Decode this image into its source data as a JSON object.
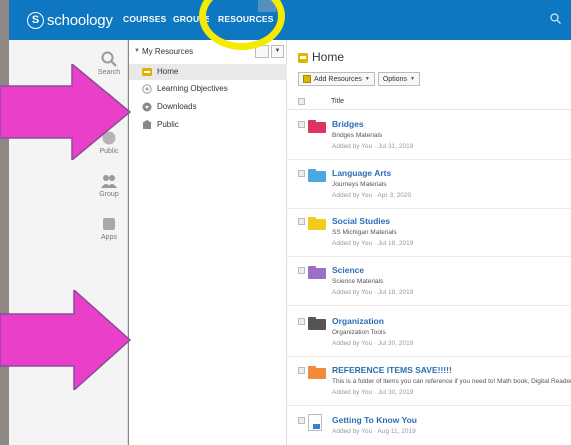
{
  "topbar": {
    "logo_glyph": "S",
    "logo_text": "schoology",
    "nav": [
      {
        "label": "COURSES"
      },
      {
        "label": "GROUPS"
      },
      {
        "label": "RESOURCES"
      }
    ]
  },
  "leftnav": {
    "items": [
      {
        "label": "Search",
        "icon": "search-icon"
      },
      {
        "label": "",
        "icon": "home-icon"
      },
      {
        "label": "Public",
        "icon": "public-icon"
      },
      {
        "label": "Group",
        "icon": "group-icon"
      },
      {
        "label": "Apps",
        "icon": "apps-icon"
      }
    ]
  },
  "tree": {
    "title": "My Resources",
    "items": [
      {
        "label": "Home",
        "icon": "folder-icon"
      },
      {
        "label": "Learning Objectives",
        "icon": "target-icon"
      },
      {
        "label": "Downloads",
        "icon": "download-icon"
      },
      {
        "label": "Public",
        "icon": "public-icon"
      }
    ]
  },
  "main": {
    "title": "Home",
    "toolbar": {
      "add_label": "Add Resources",
      "options_label": "Options"
    },
    "column_title": "Title",
    "items": [
      {
        "name": "Bridges",
        "desc": "Bridges Materials",
        "meta": "Added by You · Jul 31, 2019",
        "color": "#e0335d"
      },
      {
        "name": "Language Arts",
        "desc": "Journeys Materials",
        "meta": "Added by You · Apr 3, 2020",
        "color": "#4aa8e0"
      },
      {
        "name": "Social Studies",
        "desc": "SS Michigan Materials",
        "meta": "Added by You · Jul 18, 2019",
        "color": "#f2cc1c"
      },
      {
        "name": "Science",
        "desc": "Science Materials",
        "meta": "Added by You · Jul 18, 2019",
        "color": "#9b6fc6"
      },
      {
        "name": "Organization",
        "desc": "Organization Tools",
        "meta": "Added by You · Jul 30, 2019",
        "color": "#555555"
      },
      {
        "name": "REFERENCE ITEMS SAVE!!!!!",
        "desc": "This is a folder of items you can reference if you need to! Math book, Digital Readers",
        "meta": "Added by You · Jul 30, 2019",
        "color": "#f08a3c"
      },
      {
        "name": "Getting To Know You",
        "desc": "",
        "meta": "Added by You · Aug 11, 2019",
        "color": ""
      }
    ]
  },
  "colors": {
    "brand_blue": "#0d77c2",
    "highlight_yellow": "#f5ea00",
    "arrow_magenta": "#ea3fc8"
  }
}
